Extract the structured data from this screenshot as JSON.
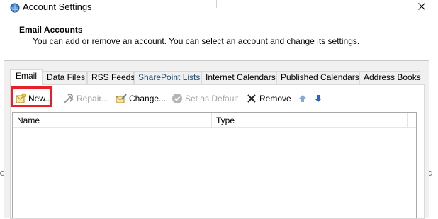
{
  "window": {
    "title": "Account Settings"
  },
  "header": {
    "title": "Email Accounts",
    "description": "You can add or remove an account. You can select an account and change its settings."
  },
  "tabs": [
    {
      "label": "Email",
      "active": true
    },
    {
      "label": "Data Files"
    },
    {
      "label": "RSS Feeds"
    },
    {
      "label": "SharePoint Lists"
    },
    {
      "label": "Internet Calendars"
    },
    {
      "label": "Published Calendars"
    },
    {
      "label": "Address Books"
    }
  ],
  "toolbar": {
    "new_label": "New...",
    "repair_label": "Repair...",
    "change_label": "Change...",
    "set_default_label": "Set as Default",
    "remove_label": "Remove"
  },
  "list": {
    "columns": [
      "Name",
      "Type"
    ],
    "rows": []
  },
  "colors": {
    "highlight": "#e8202a",
    "sharepoint_tab_text": "#1a4f7a",
    "arrow_up": "#8aa8d8",
    "arrow_down": "#2a64c8"
  }
}
